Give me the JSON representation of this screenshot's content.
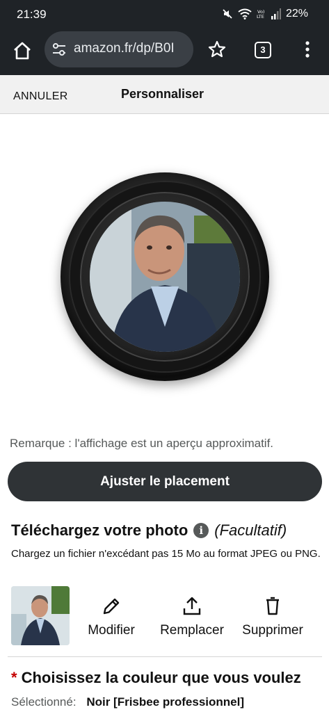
{
  "status_bar": {
    "time": "21:39",
    "battery": "22%",
    "icons": [
      "mute-icon",
      "wifi-icon",
      "volte-icon",
      "signal-icon"
    ]
  },
  "browser": {
    "url": "amazon.fr/dp/B0I",
    "tab_count": "3",
    "icons": [
      "home-icon",
      "site-settings-icon",
      "star-icon",
      "tabs-icon",
      "more-vert-icon"
    ]
  },
  "customizer": {
    "cancel_label": "ANNULER",
    "title": "Personnaliser"
  },
  "preview": {
    "note": "Remarque : l'affichage est un aperçu approximatif."
  },
  "adjust_button": "Ajuster le placement",
  "upload": {
    "title": "Téléchargez votre photo",
    "optional": "(Facultatif)",
    "description": "Chargez un fichier n'excédant pas 15 Mo au format JPEG ou PNG.",
    "actions": {
      "modify": "Modifier",
      "replace": "Remplacer",
      "delete": "Supprimer"
    }
  },
  "color": {
    "required_mark": "*",
    "title": "Choisissez la couleur que vous voulez",
    "selected_label": "Sélectionné:",
    "selected_value": "Noir [Frisbee professionnel]"
  },
  "colors": {
    "dark_bar": "#1f2327",
    "button": "#2f3336",
    "required": "#c40000"
  }
}
